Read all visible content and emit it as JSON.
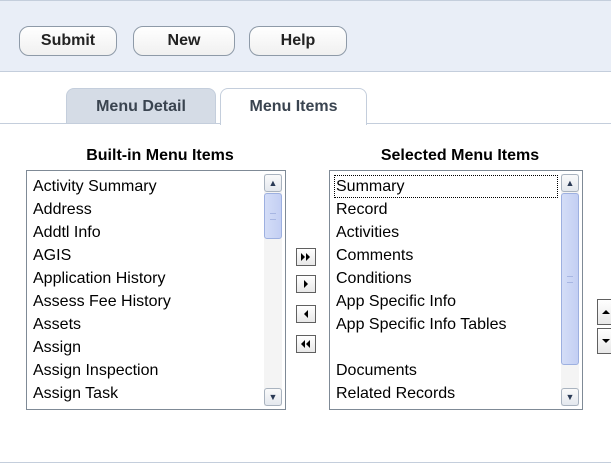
{
  "toolbar": {
    "buttons": [
      {
        "label": "Submit"
      },
      {
        "label": "New"
      },
      {
        "label": "Help"
      }
    ]
  },
  "tabs": [
    {
      "label": "Menu Detail",
      "active": false
    },
    {
      "label": "Menu Items",
      "active": true
    }
  ],
  "built_in": {
    "heading": "Built-in Menu Items",
    "items": [
      "Activity Summary",
      "Address",
      "Addtl Info",
      "AGIS",
      "Application History",
      "Assess Fee History",
      "Assets",
      "Assign",
      "Assign Inspection",
      "Assign Task"
    ]
  },
  "selected": {
    "heading": "Selected Menu Items",
    "items": [
      "Summary",
      "Record",
      "Activities",
      "Comments",
      "Conditions",
      "App Specific Info",
      "App Specific Info Tables",
      "",
      "Documents",
      "Related Records"
    ],
    "selected_index": 0
  },
  "move_buttons": {
    "icons": [
      "move-all-right-icon",
      "move-right-icon",
      "move-left-icon",
      "move-all-left-icon"
    ]
  },
  "colors": {
    "toolbar_bg": "#e9eef7",
    "tab_inactive_bg": "#d5dce6",
    "scroll_thumb": "#c3cff3"
  }
}
